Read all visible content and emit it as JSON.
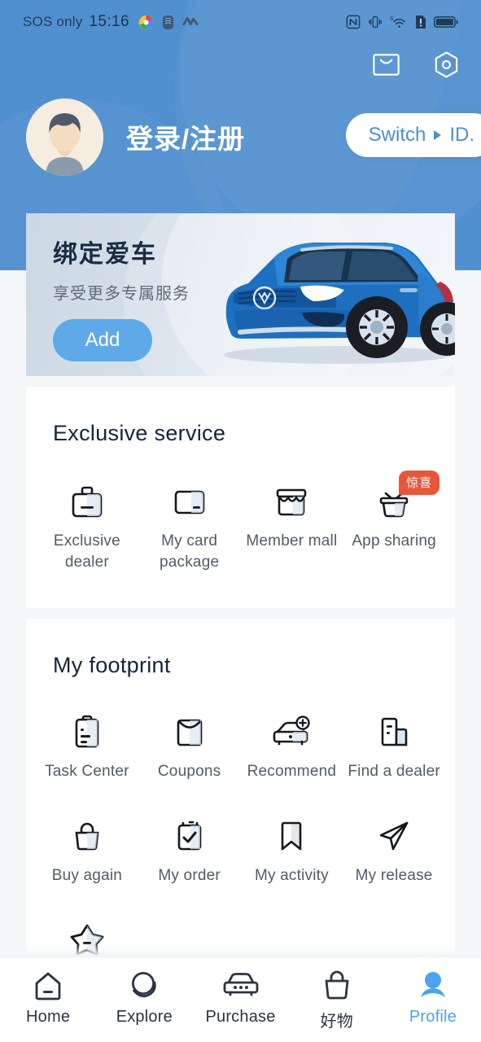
{
  "status_bar": {
    "carrier": "SOS only",
    "time": "15:16",
    "left_icons": [
      "chrome-icon",
      "fingerprint-icon",
      "health-icon"
    ],
    "right_icons": [
      "nfc-icon",
      "vibrate-icon",
      "wifi-6-icon",
      "sim-alert-icon",
      "battery-icon"
    ]
  },
  "header": {
    "bg_color": "#5190cf",
    "mail_icon": "mail-icon",
    "settings_icon": "settings-hex-icon",
    "login_label": "登录/注册",
    "switch_pill_label": "Switch",
    "switch_pill_suffix": "ID."
  },
  "car_banner": {
    "title": "绑定爱车",
    "subtitle": "享受更多专属服务",
    "add_label": "Add",
    "car_color": "#1f78c8",
    "brand": "volkswagen-logo"
  },
  "exclusive_service": {
    "title": "Exclusive service",
    "items": [
      {
        "icon": "briefcase-icon",
        "label": "Exclusive\ndealer",
        "label_line1": "Exclusive",
        "label_line2": "dealer",
        "badge": ""
      },
      {
        "icon": "card-package-icon",
        "label": "My card\npackage",
        "label_line1": "My card",
        "label_line2": "package",
        "badge": ""
      },
      {
        "icon": "storefront-icon",
        "label": "Member mall",
        "label_line1": "Member mall",
        "label_line2": "",
        "badge": ""
      },
      {
        "icon": "gift-basket-icon",
        "label": "App sharing",
        "label_line1": "App sharing",
        "label_line2": "",
        "badge": "惊喜"
      }
    ]
  },
  "my_footprint": {
    "title": "My footprint",
    "items": [
      {
        "icon": "clipboard-icon",
        "label": "Task Center"
      },
      {
        "icon": "envelope-icon",
        "label": "Coupons"
      },
      {
        "icon": "car-plus-icon",
        "label": "Recommend"
      },
      {
        "icon": "dealer-building-icon",
        "label": "Find a dealer"
      },
      {
        "icon": "shopping-bag-icon",
        "label": "Buy again"
      },
      {
        "icon": "checklist-icon",
        "label": "My order"
      },
      {
        "icon": "bookmark-icon",
        "label": "My activity"
      },
      {
        "icon": "paper-plane-icon",
        "label": "My release"
      },
      {
        "icon": "star-icon",
        "label": ""
      }
    ]
  },
  "tabbar": {
    "active_color": "#4aa3f0",
    "items": [
      {
        "icon": "home-icon",
        "label": "Home",
        "active": false
      },
      {
        "icon": "planet-icon",
        "label": "Explore",
        "active": false
      },
      {
        "icon": "car-icon",
        "label": "Purchase",
        "active": false
      },
      {
        "icon": "bag-icon",
        "label": "好物",
        "active": false
      },
      {
        "icon": "person-icon",
        "label": "Profile",
        "active": true
      }
    ]
  }
}
